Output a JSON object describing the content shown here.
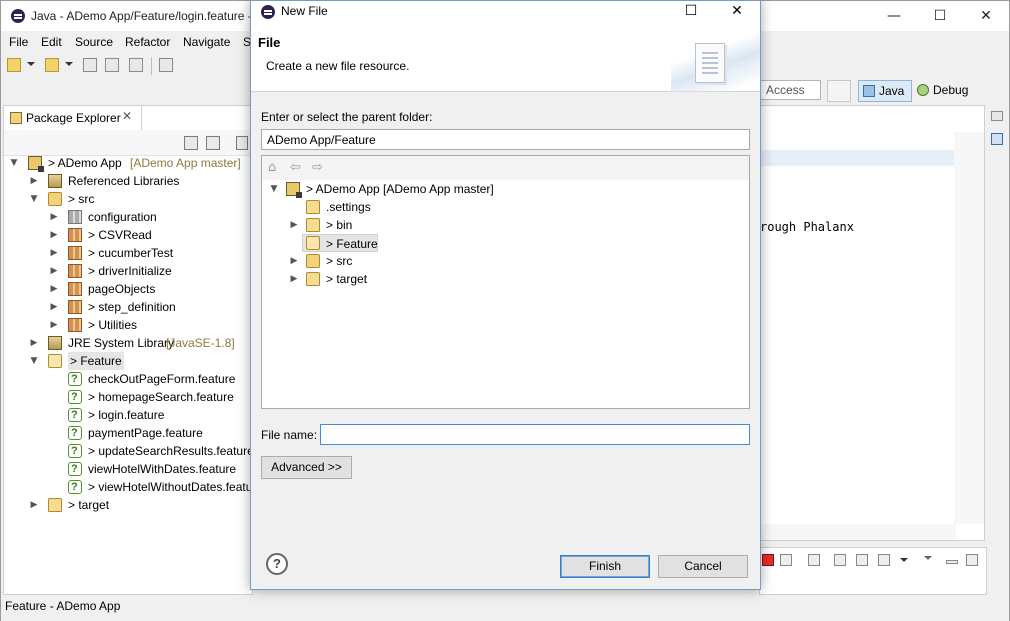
{
  "window": {
    "title": "Java - ADemo App/Feature/login.feature - Eclipse",
    "minimize": "—",
    "maximize": "☐",
    "close": "✕"
  },
  "menu": [
    "File",
    "Edit",
    "Source",
    "Refactor",
    "Navigate",
    "S"
  ],
  "quick_access": "Access",
  "perspectives": {
    "java": "Java",
    "debug": "Debug"
  },
  "package_explorer": {
    "tab_label": "Package Explorer",
    "tab_close": "✕",
    "items": [
      {
        "label": "> ADemo App",
        "deco": " [ADemo App master]"
      },
      {
        "label": "Referenced Libraries",
        "deco": ""
      },
      {
        "label": "> src",
        "deco": ""
      },
      {
        "label": "configuration",
        "deco": ""
      },
      {
        "label": "> CSVRead",
        "deco": ""
      },
      {
        "label": "> cucumberTest",
        "deco": ""
      },
      {
        "label": "> driverInitialize",
        "deco": ""
      },
      {
        "label": "pageObjects",
        "deco": ""
      },
      {
        "label": "> step_definition",
        "deco": ""
      },
      {
        "label": "> Utilities",
        "deco": ""
      },
      {
        "label": "JRE System Library",
        "deco": " [JavaSE-1.8]"
      },
      {
        "label": "> Feature",
        "deco": ""
      },
      {
        "label": "checkOutPageForm.feature",
        "deco": ""
      },
      {
        "label": "> homepageSearch.feature",
        "deco": ""
      },
      {
        "label": "> login.feature",
        "deco": ""
      },
      {
        "label": "paymentPage.feature",
        "deco": ""
      },
      {
        "label": "> updateSearchResults.feature",
        "deco": ""
      },
      {
        "label": "viewHotelWithDates.feature",
        "deco": ""
      },
      {
        "label": "> viewHotelWithoutDates.featu",
        "deco": ""
      },
      {
        "label": "> target",
        "deco": ""
      }
    ]
  },
  "editor": {
    "code_fragment": "rough Phalanx"
  },
  "status_bar": "Feature - ADemo App",
  "dialog": {
    "title": "New File",
    "heading": "File",
    "description": "Create a new file resource.",
    "parent_label": "Enter or select the parent folder:",
    "parent_value": "ADemo App/Feature",
    "tree": [
      {
        "label": "> ADemo App  [ADemo App master]"
      },
      {
        "label": ".settings"
      },
      {
        "label": "> bin"
      },
      {
        "label": "> Feature"
      },
      {
        "label": "> src"
      },
      {
        "label": "> target"
      }
    ],
    "filename_label": "File name:",
    "filename_value": "",
    "advanced_button": "Advanced >>",
    "finish_button": "Finish",
    "cancel_button": "Cancel",
    "help_icon": "?"
  }
}
